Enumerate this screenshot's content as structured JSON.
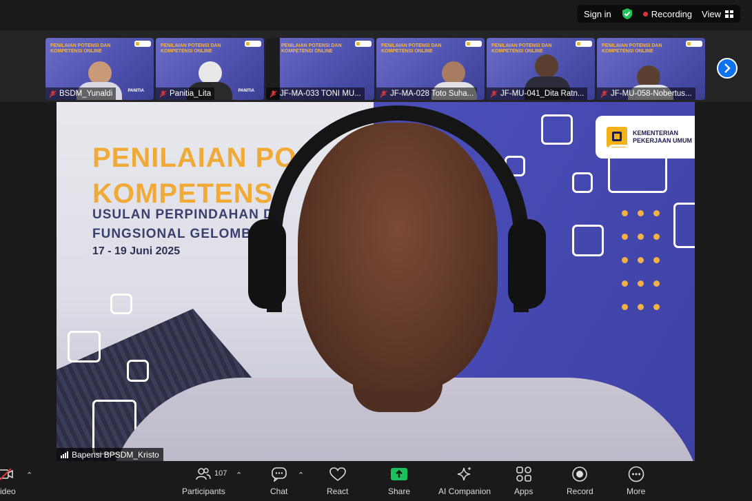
{
  "topbar": {
    "sign_in": "Sign in",
    "recording": "Recording",
    "view": "View"
  },
  "gallery": [
    {
      "name": "BSDM_Yunaldi",
      "badge": "PANITIA",
      "title": "PENILAIAN POTENSI DAN KOMPETENSI ONLINE"
    },
    {
      "name": "Panitia_Lita",
      "badge": "PANITIA",
      "title": "PENILAIAN POTENSI DAN KOMPETENSI ONLINE"
    },
    {
      "name": "JF-MA-033 TONI MU...",
      "badge": "",
      "title": "PENILAIAN POTENSI DAN KOMPETENSI ONLINE"
    },
    {
      "name": "JF-MA-028 Toto Suha...",
      "badge": "",
      "title": "PENILAIAN POTENSI DAN KOMPETENSI ONLINE"
    },
    {
      "name": "JF-MU-041_Dita Ratn...",
      "badge": "",
      "title": "PENILAIAN POTENSI DAN KOMPETENSI ONLINE"
    },
    {
      "name": "JF-MU-058-Nobertus...",
      "badge": "",
      "title": "PENILAIAN POTENSI DAN KOMPETENSI ONLINE"
    }
  ],
  "main": {
    "title_line1": "PENILAIAN PO",
    "title_line2": "KOMPETENS",
    "sub_line1": "USULAN PERPINDAHAN D",
    "sub_line2": "FUNGSIONAL GELOMB",
    "date": "17 - 19 Juni 2025",
    "org_line1": "KEMENTERIAN",
    "org_line2": "PEKERJAAN UMUM",
    "speaker": "Bapensi BPSDM_Kristo"
  },
  "toolbar": {
    "video": "ideo",
    "participants": "Participants",
    "participants_count": "107",
    "chat": "Chat",
    "react": "React",
    "share": "Share",
    "ai": "AI Companion",
    "apps": "Apps",
    "record": "Record",
    "more": "More"
  },
  "colors": {
    "share_green": "#19c35b",
    "nav_blue": "#0e72ed",
    "recording_red": "#e0323a",
    "title_orange": "#f0aa38"
  }
}
